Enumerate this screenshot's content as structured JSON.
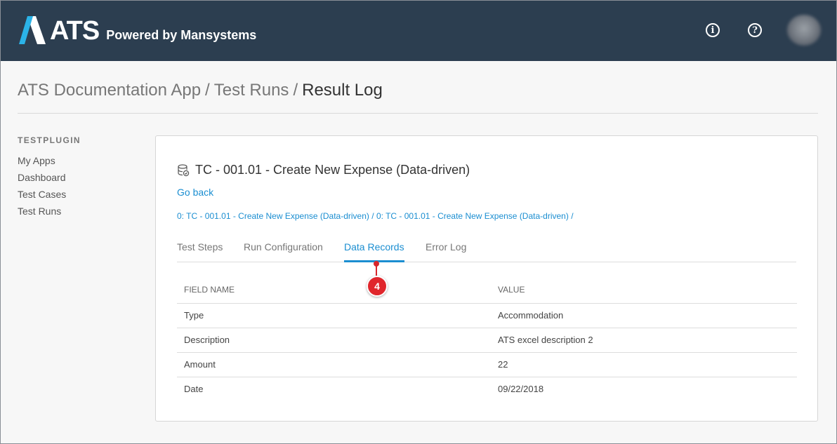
{
  "header": {
    "logo_text": "ATS",
    "tagline": "Powered by Mansystems",
    "info_icon": "info-icon",
    "help_icon": "help-icon"
  },
  "breadcrumb": {
    "items": [
      "ATS Documentation App",
      "Test Runs"
    ],
    "separator": "/",
    "current": "Result Log"
  },
  "sidebar": {
    "heading": "TESTPLUGIN",
    "items": [
      {
        "label": "My Apps"
      },
      {
        "label": "Dashboard"
      },
      {
        "label": "Test Cases"
      },
      {
        "label": "Test Runs"
      }
    ]
  },
  "card": {
    "title": "TC - 001.01 - Create New Expense (Data-driven)",
    "go_back": "Go back",
    "path": [
      "0: TC - 001.01 - Create New Expense (Data-driven)",
      "0: TC - 001.01 - Create New Expense (Data-driven)"
    ],
    "path_separator": "/",
    "tabs": [
      {
        "label": "Test Steps",
        "active": false
      },
      {
        "label": "Run Configuration",
        "active": false
      },
      {
        "label": "Data Records",
        "active": true
      },
      {
        "label": "Error Log",
        "active": false
      }
    ],
    "callout": "4",
    "table": {
      "columns": [
        "FIELD NAME",
        "VALUE"
      ],
      "rows": [
        [
          "Type",
          "Accommodation"
        ],
        [
          "Description",
          "ATS excel description 2"
        ],
        [
          "Amount",
          "22"
        ],
        [
          "Date",
          "09/22/2018"
        ]
      ]
    }
  },
  "colors": {
    "header_bg": "#2c3e50",
    "link": "#1b8ed1",
    "callout": "#e0262c",
    "logo_accent": "#2bb3e8"
  }
}
